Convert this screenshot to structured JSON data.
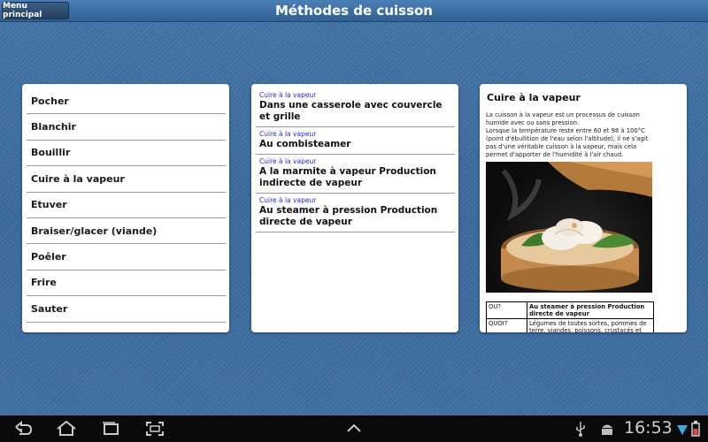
{
  "header": {
    "menu_label": "Menu principal",
    "title": "Méthodes de cuisson"
  },
  "methods": [
    {
      "label": "Pocher"
    },
    {
      "label": "Blanchir"
    },
    {
      "label": "Bouillir"
    },
    {
      "label": "Cuire à la vapeur"
    },
    {
      "label": "Etuver"
    },
    {
      "label": "Braiser/glacer (viande)"
    },
    {
      "label": "Poêler"
    },
    {
      "label": "Frire"
    },
    {
      "label": "Sauter"
    }
  ],
  "submethods": [
    {
      "category": "Cuire à la vapeur",
      "label": "Dans une casserole avec couvercle et grille"
    },
    {
      "category": "Cuire à la vapeur",
      "label": "Au combisteamer"
    },
    {
      "category": "Cuire à la vapeur",
      "label": "A la marmite à vapeur Production indirecte de vapeur"
    },
    {
      "category": "Cuire à la vapeur",
      "label": "Au steamer à pression Production directe de vapeur"
    }
  ],
  "detail": {
    "title": "Cuire à la vapeur",
    "paragraph1": "La cuisson à la vapeur est un processus de cuisson humide avec ou sans pression.",
    "paragraph2": "Lorsque la température reste entre 60 et 98 à 100°C (point d'ébullition de l'eau selon l'altitude), il ne s'agit pas d'une véritable cuisson à la vapeur, mais cela permet d'apporter de l'humidité à l'air chaud.",
    "table": [
      {
        "key": "OU?",
        "value": "Au steamer à pression Production directe de vapeur"
      },
      {
        "key": "QUOI?",
        "value": "Légumes de toutes sortes, pommes de terre, viandes, poissons, crustacés et"
      }
    ]
  },
  "system": {
    "clock": "16:53"
  }
}
